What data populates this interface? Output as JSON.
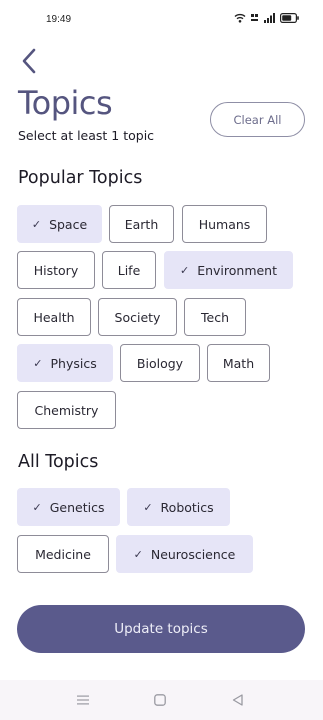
{
  "status_bar": {
    "time": "19:49",
    "icons": [
      "wifi-icon",
      "volte-icon",
      "signal-icon",
      "battery-icon"
    ]
  },
  "header": {
    "back_icon": "chevron-left-icon",
    "title": "Topics",
    "subtitle": "Select at least 1 topic",
    "clear_all_label": "Clear All"
  },
  "popular": {
    "title": "Popular Topics",
    "chips": [
      {
        "label": "Space",
        "selected": true
      },
      {
        "label": "Earth",
        "selected": false
      },
      {
        "label": "Humans",
        "selected": false
      },
      {
        "label": "History",
        "selected": false
      },
      {
        "label": "Life",
        "selected": false
      },
      {
        "label": "Environment",
        "selected": true
      },
      {
        "label": "Health",
        "selected": false
      },
      {
        "label": "Society",
        "selected": false
      },
      {
        "label": "Tech",
        "selected": false
      },
      {
        "label": "Physics",
        "selected": true
      },
      {
        "label": "Biology",
        "selected": false
      },
      {
        "label": "Math",
        "selected": false
      },
      {
        "label": "Chemistry",
        "selected": false
      }
    ]
  },
  "all": {
    "title": "All Topics",
    "chips": [
      {
        "label": "Genetics",
        "selected": true
      },
      {
        "label": "Robotics",
        "selected": true
      },
      {
        "label": "Medicine",
        "selected": false
      },
      {
        "label": "Neuroscience",
        "selected": true
      }
    ]
  },
  "update_label": "Update topics",
  "nav_bar": {
    "menu_icon": "menu-icon",
    "home_icon": "home-square-icon",
    "back_icon": "back-triangle-icon"
  },
  "colors": {
    "accent": "#5a5a8c",
    "title": "#55557f",
    "chip_selected_bg": "#e6e5f7",
    "chip_border": "#8e8c98"
  }
}
